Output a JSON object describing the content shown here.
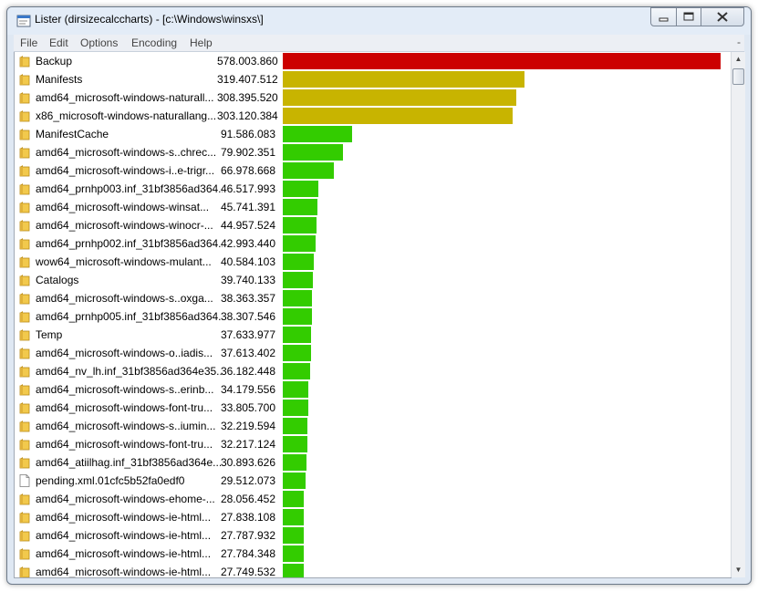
{
  "window": {
    "title": "Lister (dirsizecalccharts) - [c:\\Windows\\winsxs\\]"
  },
  "menu": {
    "items": [
      "File",
      "Edit",
      "Options",
      "Encoding",
      "Help"
    ],
    "right": "-"
  },
  "colors": {
    "red": "#cc0000",
    "yellow": "#c8b400",
    "green": "#33cc00"
  },
  "max_size": 578003860,
  "rows": [
    {
      "icon": "folder-icon",
      "name": "Backup",
      "size": "578.003.860",
      "value": 578003860,
      "color": "red"
    },
    {
      "icon": "folder-icon",
      "name": "Manifests",
      "size": "319.407.512",
      "value": 319407512,
      "color": "yellow"
    },
    {
      "icon": "folder-icon",
      "name": "amd64_microsoft-windows-naturall...",
      "size": "308.395.520",
      "value": 308395520,
      "color": "yellow"
    },
    {
      "icon": "folder-icon",
      "name": "x86_microsoft-windows-naturallang...",
      "size": "303.120.384",
      "value": 303120384,
      "color": "yellow"
    },
    {
      "icon": "folder-icon",
      "name": "ManifestCache",
      "size": "91.586.083",
      "value": 91586083,
      "color": "green"
    },
    {
      "icon": "folder-icon",
      "name": "amd64_microsoft-windows-s..chrec...",
      "size": "79.902.351",
      "value": 79902351,
      "color": "green"
    },
    {
      "icon": "folder-icon",
      "name": "amd64_microsoft-windows-i..e-trigr...",
      "size": "66.978.668",
      "value": 66978668,
      "color": "green"
    },
    {
      "icon": "folder-icon",
      "name": "amd64_prnhp003.inf_31bf3856ad364...",
      "size": "46.517.993",
      "value": 46517993,
      "color": "green"
    },
    {
      "icon": "folder-icon",
      "name": "amd64_microsoft-windows-winsat...",
      "size": "45.741.391",
      "value": 45741391,
      "color": "green"
    },
    {
      "icon": "folder-icon",
      "name": "amd64_microsoft-windows-winocr-...",
      "size": "44.957.524",
      "value": 44957524,
      "color": "green"
    },
    {
      "icon": "folder-icon",
      "name": "amd64_prnhp002.inf_31bf3856ad364...",
      "size": "42.993.440",
      "value": 42993440,
      "color": "green"
    },
    {
      "icon": "folder-icon",
      "name": "wow64_microsoft-windows-mulant...",
      "size": "40.584.103",
      "value": 40584103,
      "color": "green"
    },
    {
      "icon": "folder-icon",
      "name": "Catalogs",
      "size": "39.740.133",
      "value": 39740133,
      "color": "green"
    },
    {
      "icon": "folder-icon",
      "name": "amd64_microsoft-windows-s..oxga...",
      "size": "38.363.357",
      "value": 38363357,
      "color": "green"
    },
    {
      "icon": "folder-icon",
      "name": "amd64_prnhp005.inf_31bf3856ad364...",
      "size": "38.307.546",
      "value": 38307546,
      "color": "green"
    },
    {
      "icon": "folder-icon",
      "name": "Temp",
      "size": "37.633.977",
      "value": 37633977,
      "color": "green"
    },
    {
      "icon": "folder-icon",
      "name": "amd64_microsoft-windows-o..iadis...",
      "size": "37.613.402",
      "value": 37613402,
      "color": "green"
    },
    {
      "icon": "folder-icon",
      "name": "amd64_nv_lh.inf_31bf3856ad364e35...",
      "size": "36.182.448",
      "value": 36182448,
      "color": "green"
    },
    {
      "icon": "folder-icon",
      "name": "amd64_microsoft-windows-s..erinb...",
      "size": "34.179.556",
      "value": 34179556,
      "color": "green"
    },
    {
      "icon": "folder-icon",
      "name": "amd64_microsoft-windows-font-tru...",
      "size": "33.805.700",
      "value": 33805700,
      "color": "green"
    },
    {
      "icon": "folder-icon",
      "name": "amd64_microsoft-windows-s..iumin...",
      "size": "32.219.594",
      "value": 32219594,
      "color": "green"
    },
    {
      "icon": "folder-icon",
      "name": "amd64_microsoft-windows-font-tru...",
      "size": "32.217.124",
      "value": 32217124,
      "color": "green"
    },
    {
      "icon": "folder-icon",
      "name": "amd64_atiilhag.inf_31bf3856ad364e...",
      "size": "30.893.626",
      "value": 30893626,
      "color": "green"
    },
    {
      "icon": "file-icon",
      "name": "pending.xml.01cfc5b52fa0edf0",
      "size": "29.512.073",
      "value": 29512073,
      "color": "green"
    },
    {
      "icon": "folder-icon",
      "name": "amd64_microsoft-windows-ehome-...",
      "size": "28.056.452",
      "value": 28056452,
      "color": "green"
    },
    {
      "icon": "folder-icon",
      "name": "amd64_microsoft-windows-ie-html...",
      "size": "27.838.108",
      "value": 27838108,
      "color": "green"
    },
    {
      "icon": "folder-icon",
      "name": "amd64_microsoft-windows-ie-html...",
      "size": "27.787.932",
      "value": 27787932,
      "color": "green"
    },
    {
      "icon": "folder-icon",
      "name": "amd64_microsoft-windows-ie-html...",
      "size": "27.784.348",
      "value": 27784348,
      "color": "green"
    },
    {
      "icon": "folder-icon",
      "name": "amd64_microsoft-windows-ie-html...",
      "size": "27.749.532",
      "value": 27749532,
      "color": "green"
    }
  ]
}
